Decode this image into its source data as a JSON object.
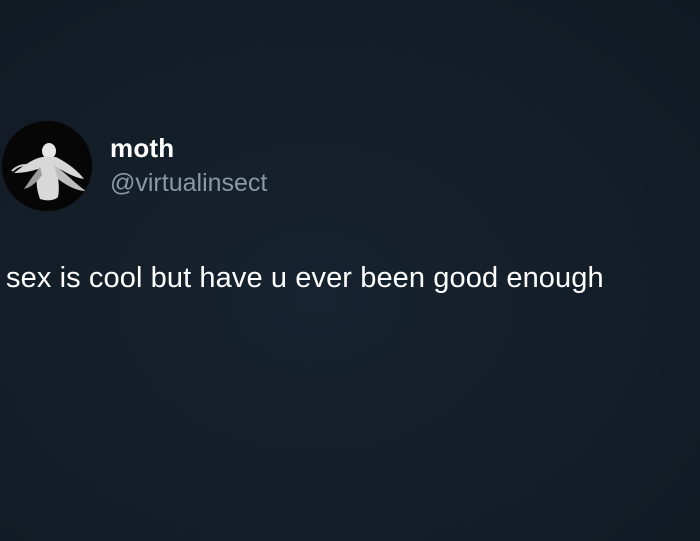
{
  "tweet": {
    "author": {
      "display_name": "moth",
      "handle": "@virtualinsect",
      "avatar_icon": "moth-figure-avatar"
    },
    "text": "sex is cool but have u ever been good enough"
  },
  "colors": {
    "background": "#15202b",
    "text_primary": "#ffffff",
    "text_secondary": "#8b98a5"
  }
}
